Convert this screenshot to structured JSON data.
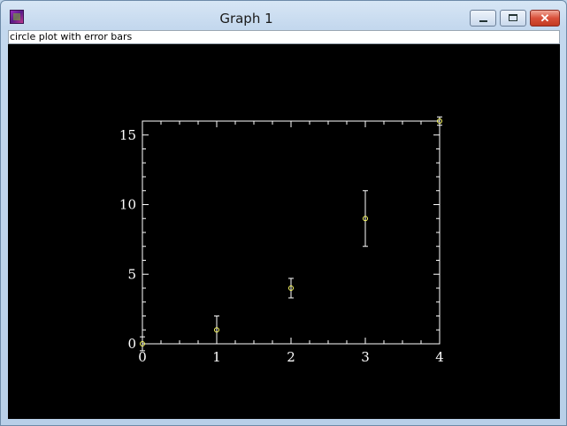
{
  "window": {
    "title": "Graph 1",
    "icon": "graph-app-icon",
    "controls": {
      "minimize": "minimize-icon",
      "maximize": "maximize-icon",
      "close": "close-icon",
      "close_glyph": "✕"
    }
  },
  "caption": "circle plot with error bars",
  "colors": {
    "background": "#000000",
    "axis": "#ffffff",
    "marker": "#ffff66",
    "errorbar": "#ffffff"
  },
  "chart_data": {
    "type": "scatter",
    "title": "",
    "xlabel": "",
    "ylabel": "",
    "xlim": [
      0,
      4
    ],
    "ylim": [
      0,
      16
    ],
    "xticks": [
      0,
      1,
      2,
      3,
      4
    ],
    "yticks": [
      0,
      5,
      10,
      15
    ],
    "grid": false,
    "series": [
      {
        "marker": "circle",
        "x": [
          0,
          1,
          2,
          3,
          4
        ],
        "y": [
          0,
          1,
          4,
          9,
          16
        ],
        "yerr": [
          0.5,
          1.0,
          0.7,
          2.0,
          0.3
        ]
      }
    ]
  }
}
